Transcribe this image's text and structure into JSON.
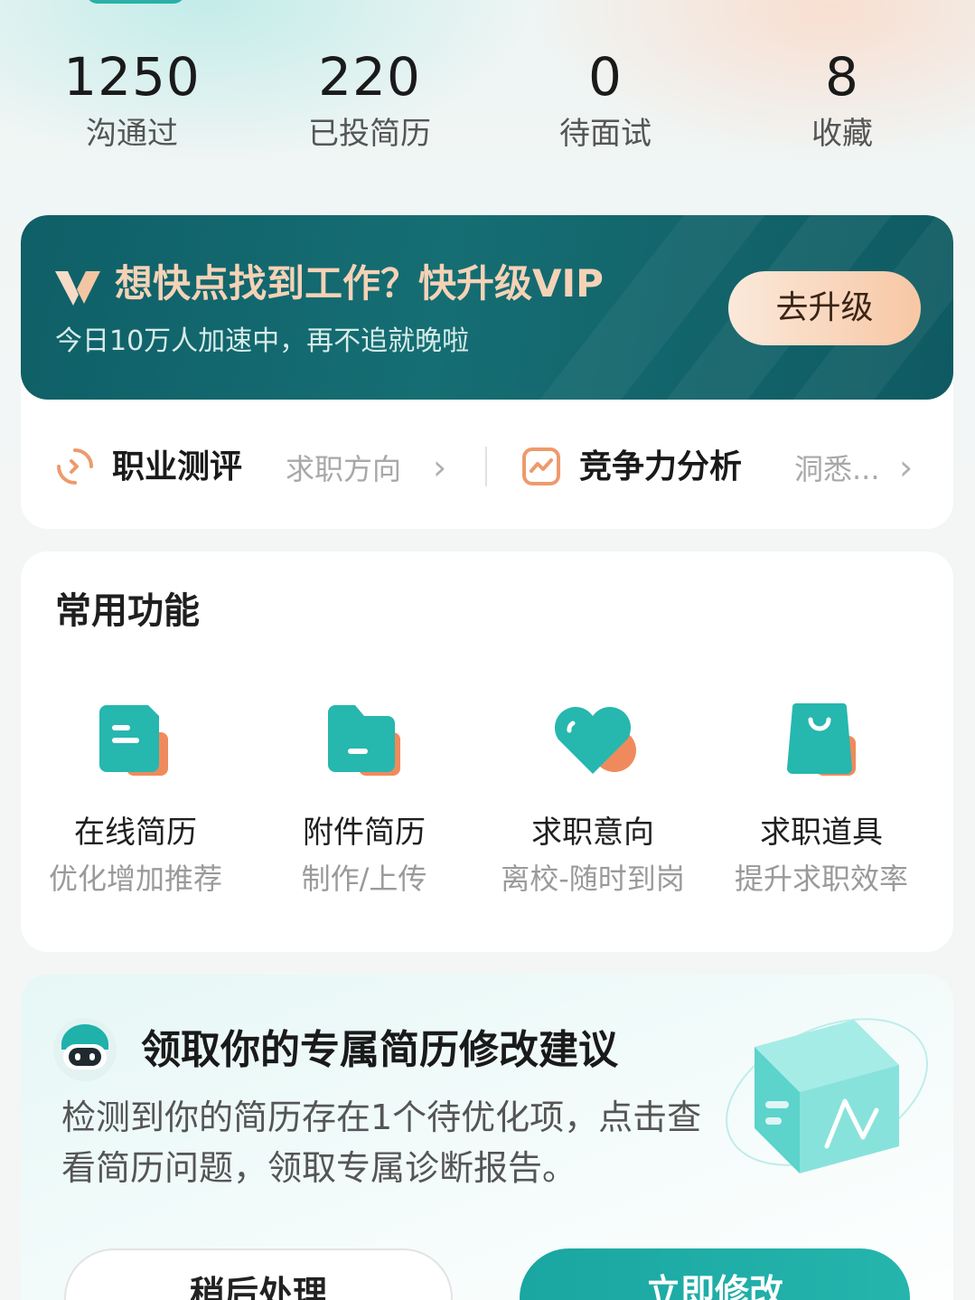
{
  "stats": [
    {
      "value": "1250",
      "label": "沟通过"
    },
    {
      "value": "220",
      "label": "已投简历"
    },
    {
      "value": "0",
      "label": "待面试"
    },
    {
      "value": "8",
      "label": "收藏"
    }
  ],
  "vip": {
    "title": "想快点找到工作？快升级VIP",
    "subtitle": "今日10万人加速中，再不追就晚啦",
    "button": "去升级"
  },
  "tools": {
    "career_test": {
      "title": "职业测评",
      "subtitle": "求职方向"
    },
    "competitiveness": {
      "title": "竞争力分析",
      "subtitle": "洞悉..."
    }
  },
  "common": {
    "title": "常用功能",
    "items": [
      {
        "name": "在线简历",
        "desc": "优化增加推荐",
        "icon": "resume-doc-icon"
      },
      {
        "name": "附件简历",
        "desc": "制作/上传",
        "icon": "folder-icon"
      },
      {
        "name": "求职意向",
        "desc": "离校-随时到岗",
        "icon": "heart-icon"
      },
      {
        "name": "求职道具",
        "desc": "提升求职效率",
        "icon": "shopping-bag-icon"
      }
    ]
  },
  "advice": {
    "title": "领取你的专属简历修改建议",
    "text": "检测到你的简历存在1个待优化项，点击查看简历问题，领取专属诊断报告。",
    "later_button": "稍后处理",
    "now_button": "立即修改"
  },
  "colors": {
    "accent": "#1aa6a1",
    "vip_bg": "#156e73",
    "vip_text": "#f5d2b6",
    "orange": "#f08a5d"
  }
}
